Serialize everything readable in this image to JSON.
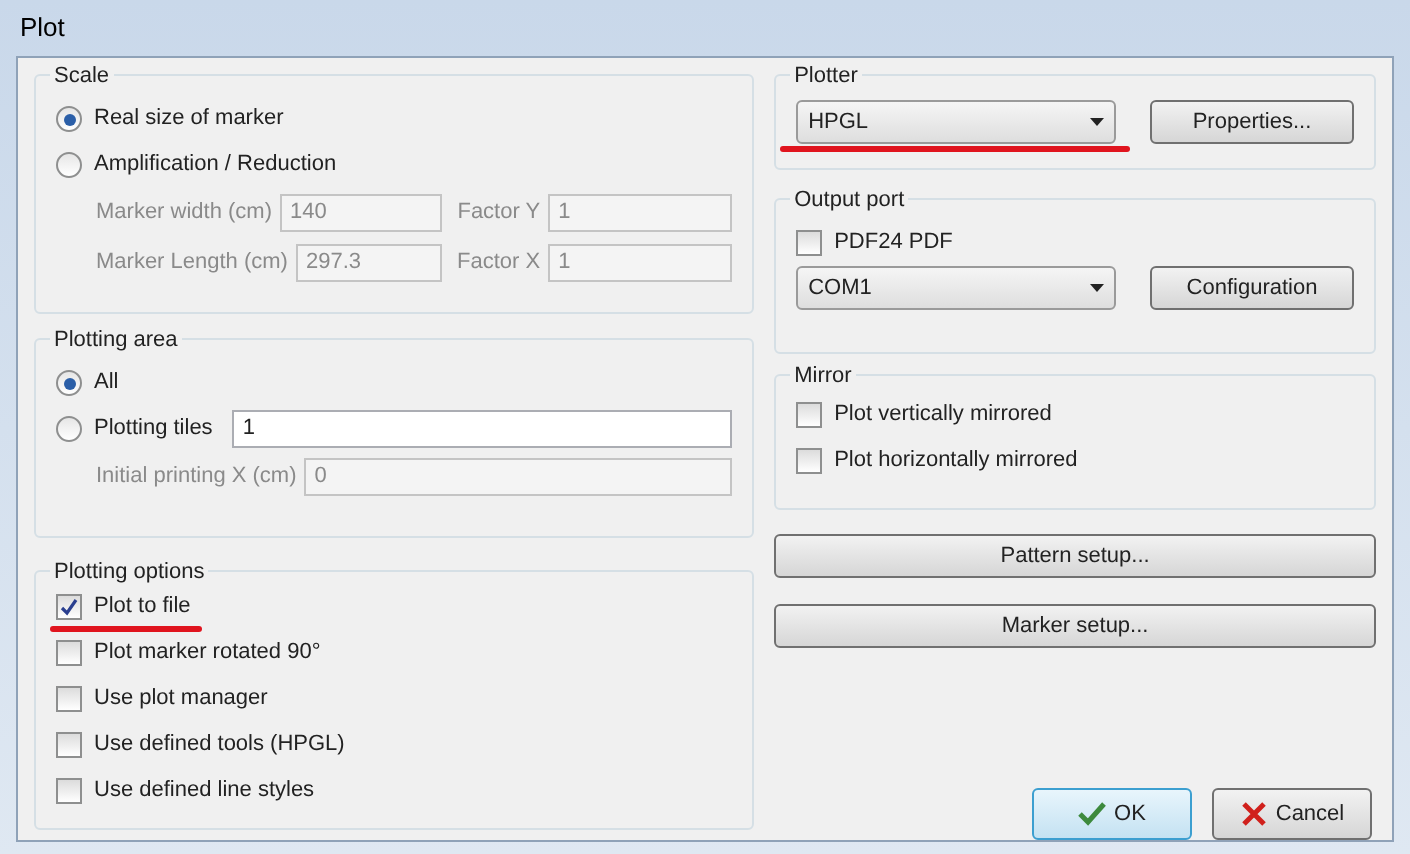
{
  "window": {
    "title": "Plot"
  },
  "scale": {
    "title": "Scale",
    "options": [
      {
        "label": "Real size of marker",
        "selected": true
      },
      {
        "label": "Amplification / Reduction",
        "selected": false
      }
    ],
    "fields": [
      {
        "label": "Marker width (cm)",
        "value": "140",
        "factor_label": "Factor Y",
        "factor_value": "1",
        "disabled": true
      },
      {
        "label": "Marker Length (cm)",
        "value": "297.3",
        "factor_label": "Factor X",
        "factor_value": "1",
        "disabled": true
      }
    ]
  },
  "plotting_area": {
    "title": "Plotting area",
    "options": [
      {
        "label": "All",
        "selected": true
      },
      {
        "label": "Plotting tiles",
        "selected": false,
        "value": "1"
      }
    ],
    "initial": {
      "label": "Initial printing X (cm)",
      "value": "0",
      "disabled": true
    }
  },
  "plotting_options": {
    "title": "Plotting options",
    "items": [
      {
        "label": "Plot to file",
        "checked": true,
        "underlined": true
      },
      {
        "label": "Plot marker rotated 90°",
        "checked": false,
        "underlined": false
      },
      {
        "label": "Use plot manager",
        "checked": false,
        "underlined": false
      },
      {
        "label": "Use defined tools (HPGL)",
        "checked": false,
        "underlined": false
      },
      {
        "label": "Use defined line styles",
        "checked": false,
        "underlined": false
      }
    ]
  },
  "plotter": {
    "title": "Plotter",
    "value": "HPGL",
    "underlined": true,
    "button": "Properties..."
  },
  "output_port": {
    "title": "Output port",
    "checkbox": {
      "label": "PDF24 PDF",
      "checked": false
    },
    "value": "COM1",
    "button": "Configuration"
  },
  "mirror": {
    "title": "Mirror",
    "items": [
      {
        "label": "Plot vertically mirrored",
        "checked": false
      },
      {
        "label": "Plot horizontally mirrored",
        "checked": false
      }
    ]
  },
  "setup_buttons": [
    "Pattern setup...",
    "Marker setup..."
  ],
  "buttons": [
    {
      "kind": "ok",
      "label": "OK"
    },
    {
      "kind": "cancel",
      "label": "Cancel"
    }
  ]
}
